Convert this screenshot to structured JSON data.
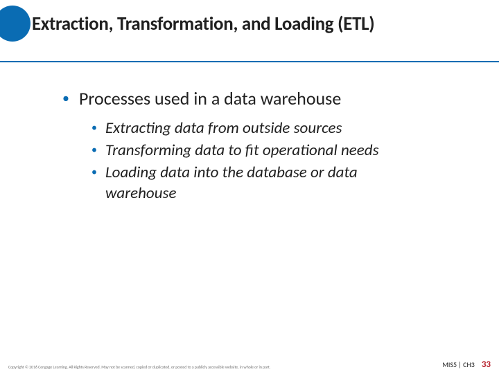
{
  "header": {
    "title": "Extraction, Transformation, and Loading (ETL)"
  },
  "bullets": {
    "main": "Processes used in a data warehouse",
    "sub": [
      "Extracting data from outside sources",
      "Transforming data to fit operational needs",
      "Loading data into the database or data warehouse"
    ]
  },
  "footer": {
    "copyright": "Copyright © 2016 Cengage Learning. All Rights Reserved. May not be scanned, copied or duplicated, or posted to a publicly accessible website, in whole or in part.",
    "course": "MIS5 | CH3",
    "page": "33"
  }
}
